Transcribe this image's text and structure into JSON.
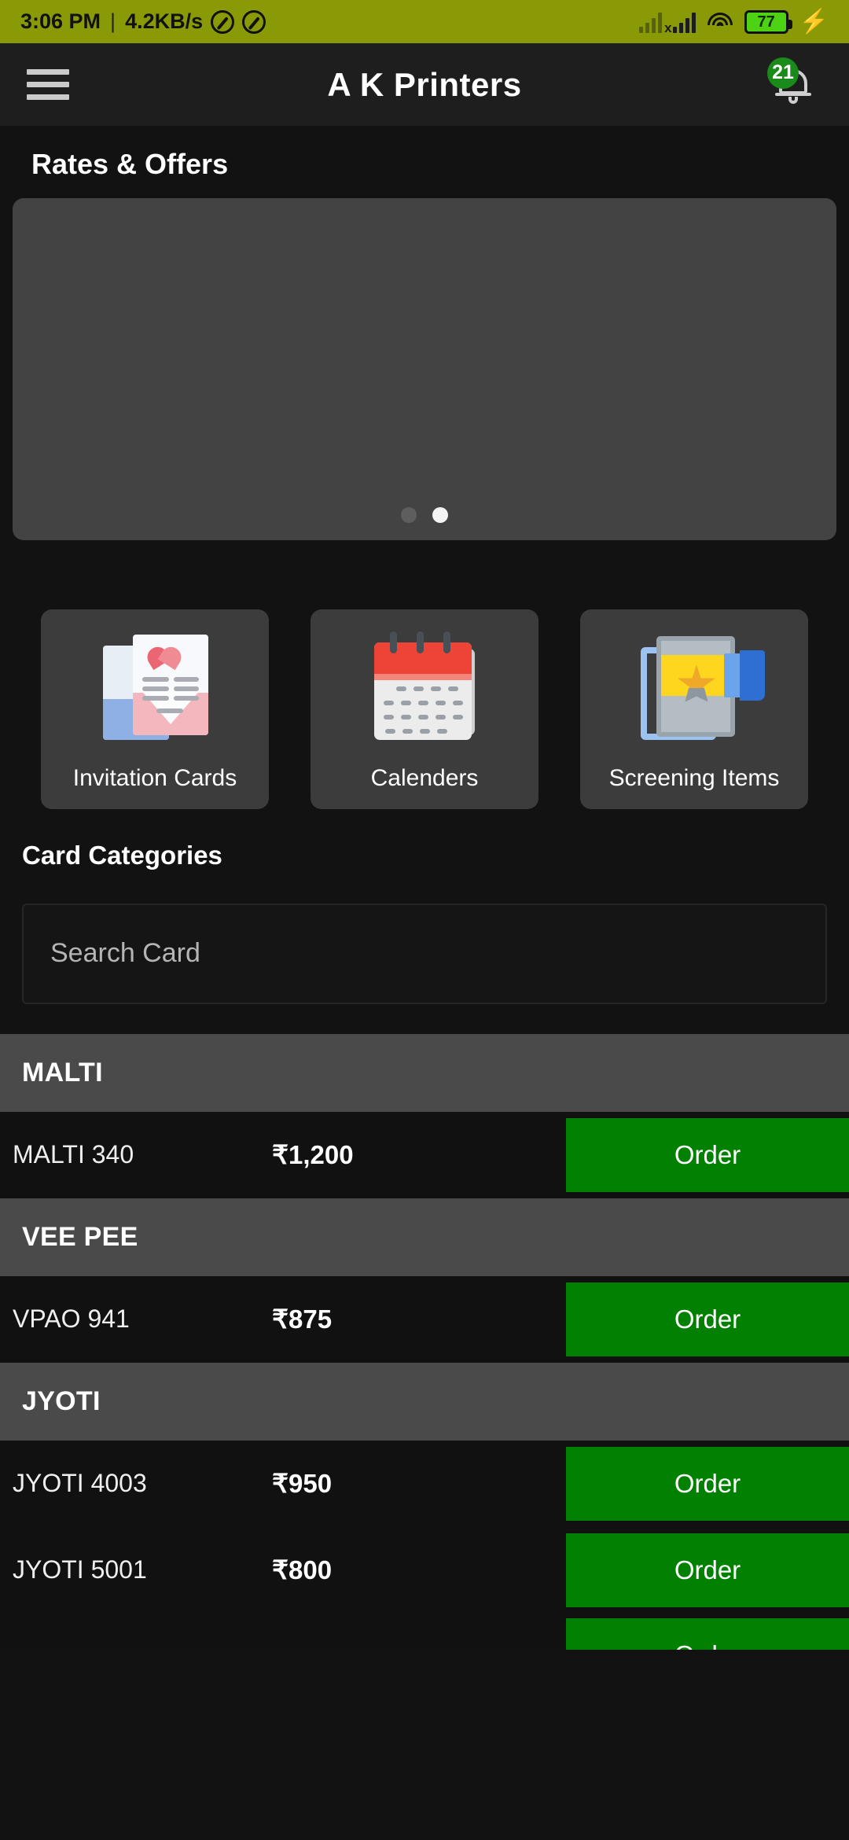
{
  "status_bar": {
    "time": "3:06 PM",
    "separator": "|",
    "network_speed": "4.2KB/s",
    "dnd_icon": "do-not-disturb-icon",
    "dnd_icon_2": "do-not-disturb-icon",
    "signal_1": "signal-bars-no-service-icon",
    "signal_2": "signal-bars-icon",
    "wifi": "wifi-icon",
    "battery_level": "77",
    "charging_icon": "lightning-bolt-icon",
    "bar_color": "#8a9a06"
  },
  "app_bar": {
    "menu_icon": "hamburger-menu-icon",
    "title": "A K Printers",
    "bell_icon": "notification-bell-icon",
    "notification_count": "21",
    "badge_color": "#1a8a1a",
    "background": "#1e1e1e"
  },
  "rates_section": {
    "title": "Rates & Offers",
    "banner_color": "#434343",
    "carousel_dots": [
      {
        "active": false
      },
      {
        "active": true
      }
    ]
  },
  "category_tiles": [
    {
      "label": "Invitation Cards",
      "icon": "invitation-card-icon"
    },
    {
      "label": "Calenders",
      "icon": "calendar-icon"
    },
    {
      "label": "Screening Items",
      "icon": "screening-item-icon"
    }
  ],
  "card_categories": {
    "title": "Card Categories",
    "search_placeholder": "Search Card",
    "search_value": ""
  },
  "order_button_label": "Order",
  "order_button_color": "#018001",
  "groups": [
    {
      "name": "MALTI",
      "items": [
        {
          "name": "MALTI 340",
          "price": "₹1,200",
          "action": "Order"
        }
      ]
    },
    {
      "name": "VEE PEE",
      "items": [
        {
          "name": "VPAO 941",
          "price": "₹875",
          "action": "Order"
        }
      ]
    },
    {
      "name": "JYOTI",
      "items": [
        {
          "name": "JYOTI 4003",
          "price": "₹950",
          "action": "Order"
        },
        {
          "name": "JYOTI 5001",
          "price": "₹800",
          "action": "Order"
        },
        {
          "name": "",
          "price": "",
          "action": "Order"
        }
      ]
    }
  ]
}
